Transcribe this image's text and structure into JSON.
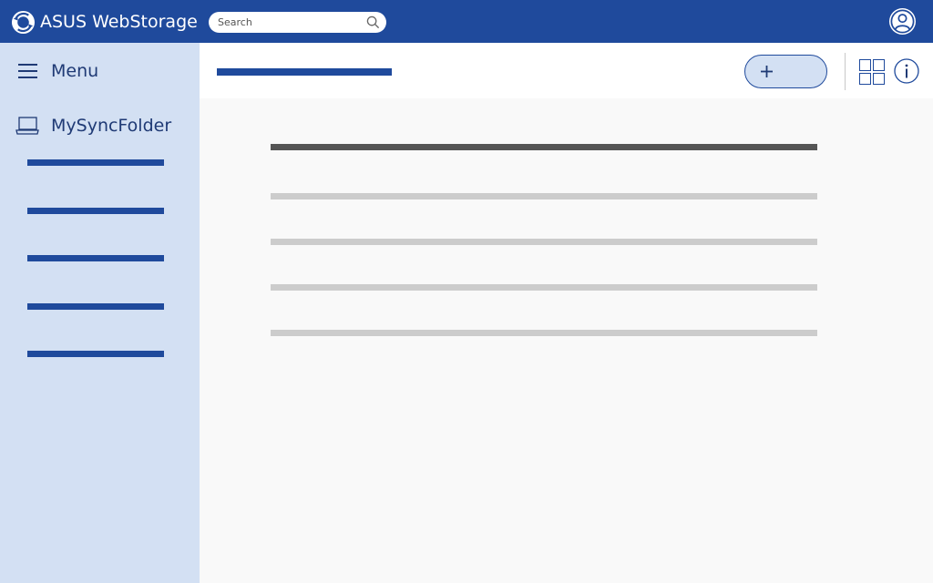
{
  "app": {
    "brand_name": "ASUS WebStorage",
    "brand_color": "#1f4a9c",
    "sidebar_color": "#d3e0f3"
  },
  "search": {
    "placeholder": "Search",
    "icon": "search-icon"
  },
  "header": {
    "account_icon": "user-account-icon"
  },
  "sidebar": {
    "menu_label": "Menu",
    "menu_icon": "hamburger-icon",
    "folder_label": "MySyncFolder",
    "folder_icon": "laptop-folder-icon",
    "items_count": 5
  },
  "toolbar": {
    "add_icon": "plus-icon",
    "view_icon": "grid-view-icon",
    "info_icon": "info-icon"
  },
  "content": {
    "header_row_color": "#555555",
    "row_color": "#cccccc",
    "rows_count": 5
  }
}
